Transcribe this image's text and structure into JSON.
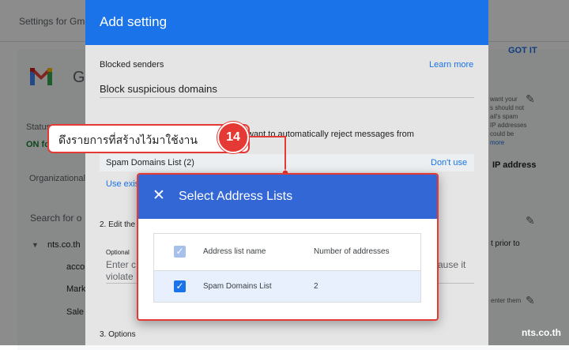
{
  "background": {
    "breadcrumb": "Settings for Gma",
    "app_letter": "G",
    "status_label": "Status",
    "status_value": "ON fo",
    "org_label": "Organizational",
    "search_placeholder": "Search for o",
    "org_root": "nts.co.th",
    "org_children": [
      "acco",
      "Mark",
      "Sale"
    ],
    "got_it": "GOT IT",
    "right_snippets": [
      "want your",
      "s should not",
      "ail's spam",
      "IP addresses",
      "could be",
      "more"
    ],
    "ip_address": "IP address",
    "prior_to": "t prior to",
    "enter_them": "enter them"
  },
  "panel": {
    "title": "Add setting",
    "blocked_senders": "Blocked senders",
    "learn_more": "Learn more",
    "setting_name": "Block suspicious domains",
    "reject_text": "want to automatically reject messages from",
    "list_name": "Spam Domains List (2)",
    "dont_use": "Don't use",
    "use_existing": "Use exis",
    "section_edit": "2. Edit the",
    "optional_label": "Optional",
    "enter_text": "Enter c",
    "violate_text": "violate",
    "cause_it": "ause it",
    "section_options": "3. Options"
  },
  "dialog": {
    "title": "Select Address Lists",
    "close_icon": "close-icon",
    "col_name": "Address list name",
    "col_count": "Number of addresses",
    "rows": [
      {
        "name": "Spam Domains List",
        "count": "2",
        "checked": true
      }
    ]
  },
  "callout": {
    "text": "ดึงรายการที่สร้างไว้มาใช้งาน",
    "step": "14"
  },
  "watermark": "nts.co.th",
  "colors": {
    "header_blue": "#1a73e8",
    "dialog_blue": "#3367d6",
    "highlight_red": "#e53935",
    "row_highlight": "#e8f0fe"
  }
}
